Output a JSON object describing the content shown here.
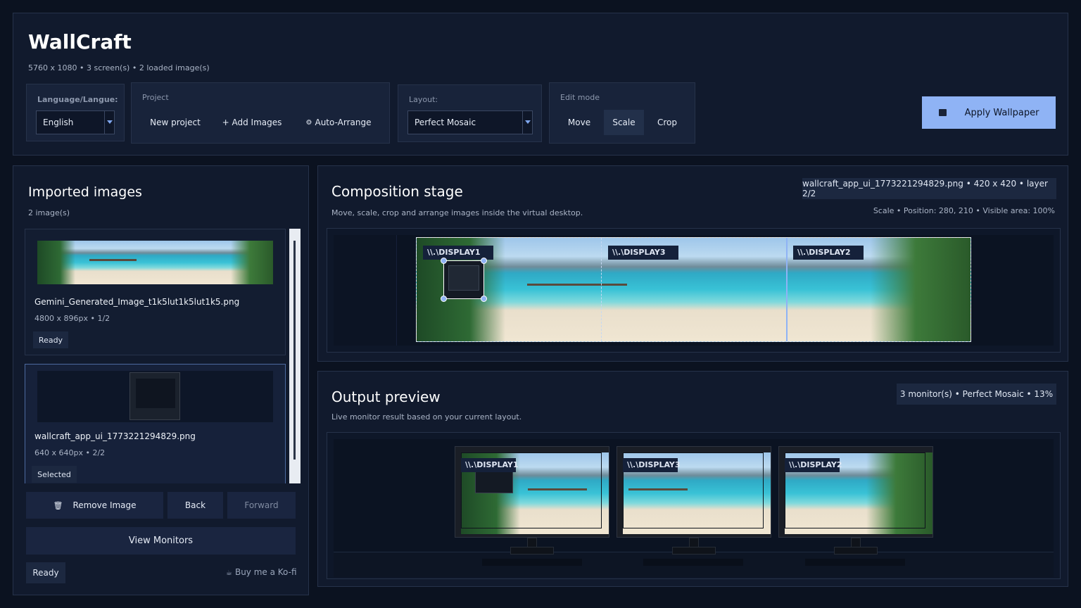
{
  "app": {
    "title": "WallCraft",
    "subtitle": "5760 x 1080  •  3 screen(s)  •  2 loaded image(s)"
  },
  "toolbar": {
    "language_label": "Language/Langue:",
    "language_value": "English",
    "project_label": "Project",
    "new_project": "New project",
    "add_images": "+ Add Images",
    "auto_arrange": "Auto-Arrange",
    "layout_label": "Layout:",
    "layout_value": "Perfect Mosaic",
    "edit_mode_label": "Edit mode",
    "mode_move": "Move",
    "mode_scale": "Scale",
    "mode_crop": "Crop",
    "active_mode": "Scale",
    "apply": "Apply Wallpaper"
  },
  "images_panel": {
    "title": "Imported images",
    "count": "2 image(s)",
    "items": [
      {
        "name": "Gemini_Generated_Image_t1k5lut1k5lut1k5.png",
        "meta": "4800 x 896px  •  1/2",
        "status": "Ready",
        "selected": false
      },
      {
        "name": "wallcraft_app_ui_1773221294829.png",
        "meta": "640 x 640px  •  2/2",
        "status": "Selected",
        "selected": true
      }
    ],
    "remove": "Remove Image",
    "back": "Back",
    "forward": "Forward",
    "view_monitors": "View Monitors",
    "status": "Ready",
    "kofi": "Buy me a Ko-fi"
  },
  "stage": {
    "title": "Composition stage",
    "subtitle": "Move, scale, crop and arrange images inside the virtual desktop.",
    "info": "wallcraft_app_ui_1773221294829.png  •  420 x 420  •  layer 2/2",
    "status": "Scale  •  Position: 280, 210  •  Visible area: 100%",
    "displays": [
      "\\\\.\\DISPLAY1",
      "\\\\.\\DISPLAY3",
      "\\\\.\\DISPLAY2"
    ]
  },
  "preview": {
    "title": "Output preview",
    "subtitle": "Live monitor result based on your current layout.",
    "info": "3 monitor(s)  •  Perfect Mosaic  •  13%",
    "displays": [
      "\\\\.\\DISPLAY1",
      "\\\\.\\DISPLAY3",
      "\\\\.\\DISPLAY2"
    ]
  },
  "colors": {
    "accent": "#8fb3f5",
    "background": "#0b1220",
    "panel": "#111a2d"
  }
}
